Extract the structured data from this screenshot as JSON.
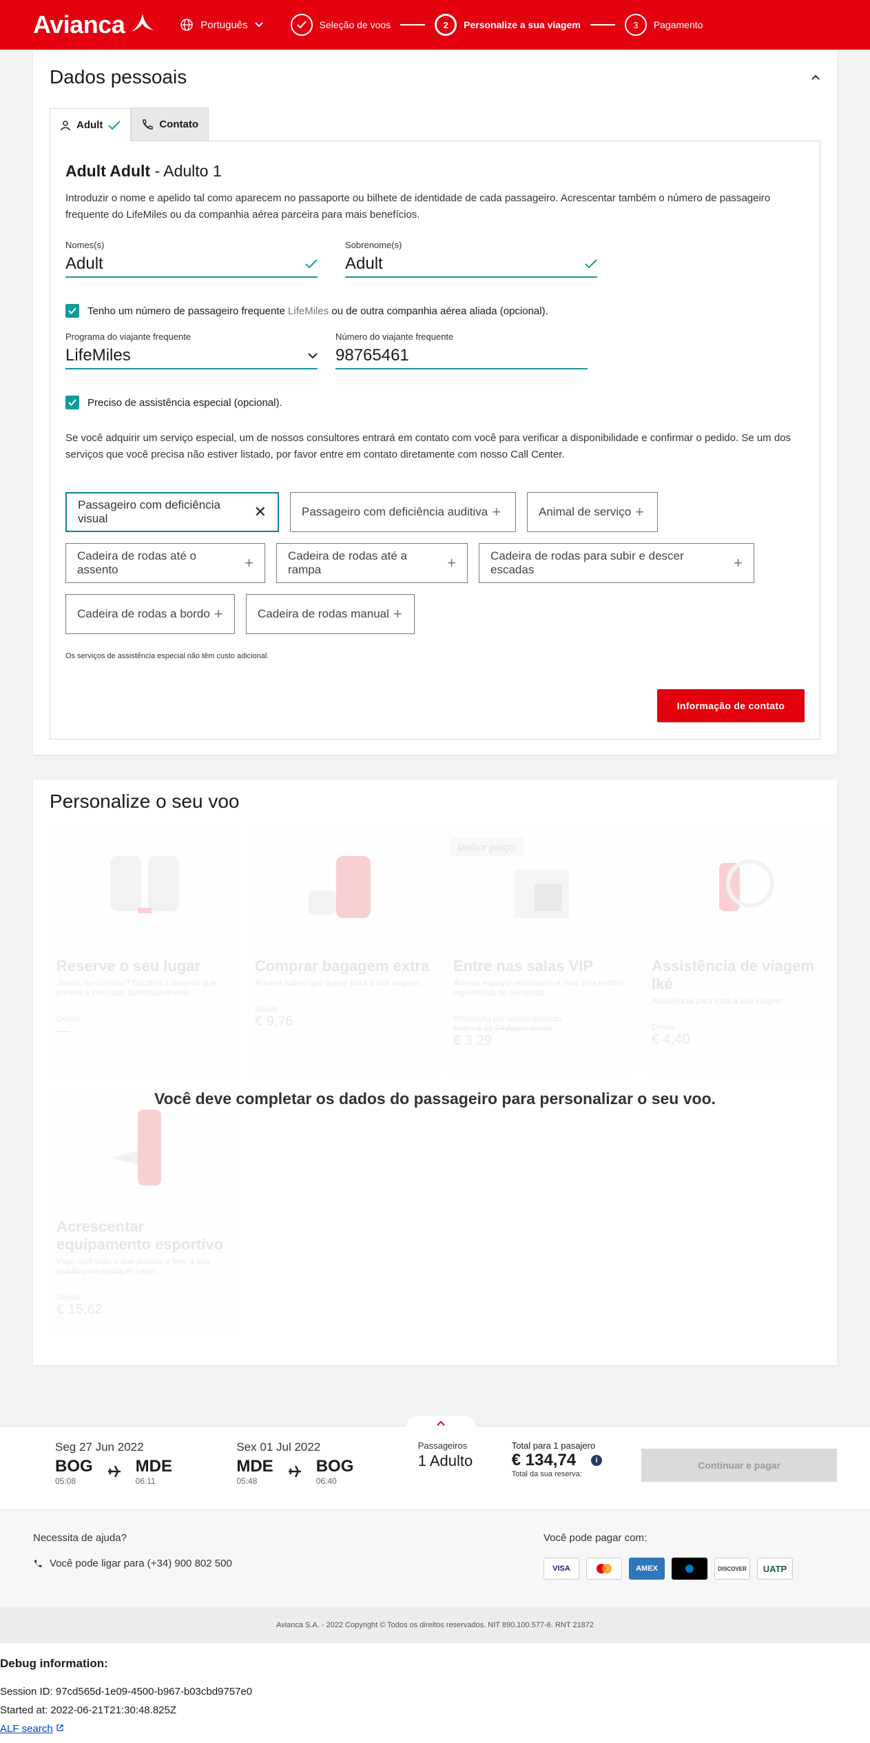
{
  "header": {
    "brand": "Avianca",
    "language": "Português",
    "steps": [
      {
        "number": "",
        "label": "Seleção de voos"
      },
      {
        "number": "2",
        "label": "Personalize a sua viagem"
      },
      {
        "number": "3",
        "label": "Pagamento"
      }
    ]
  },
  "personal": {
    "title": "Dados pessoais",
    "tabs": [
      {
        "label": "Adult"
      },
      {
        "label": "Contato"
      }
    ],
    "passenger_name": "Adult Adult",
    "passenger_index": "- Adulto 1",
    "intro": "Introduzir o nome e apelido tal como aparecem no passaporte ou bilhete de identidade de cada passageiro. Acrescentar também o número de passageiro frequente do LifeMiles ou da companhia aérea parceira para mais benefícios.",
    "first_name_label": "Nomes(s)",
    "first_name_value": "Adult",
    "last_name_label": "Sobrenome(s)",
    "last_name_value": "Adult",
    "ff_check_pre": "Tenho um número de passageiro frequente",
    "ff_check_brand": "LifeMiles",
    "ff_check_post": "ou de outra companhia aérea aliada (opcional).",
    "program_label": "Programa do viajante frequente",
    "program_value": "LifeMiles",
    "ff_number_label": "Número do viajante frequente",
    "ff_number_value": "98765461",
    "assist_check": "Preciso de assistência especial (opcional).",
    "assist_info": "Se você adquirir um serviço especial, um de nossos consultores entrará em contato com você para verificar a disponibilidade e confirmar o pedido. Se um dos serviços que você precisa não estiver listado, por favor entre em contato diretamente com nosso Call Center.",
    "services": [
      {
        "label": "Passageiro com deficiência visual",
        "selected": true
      },
      {
        "label": "Passageiro com deficiência auditiva",
        "selected": false
      },
      {
        "label": "Animal de serviço",
        "selected": false
      },
      {
        "label": "Cadeira de rodas até o assento",
        "selected": false
      },
      {
        "label": "Cadeira de rodas até a rampa",
        "selected": false
      },
      {
        "label": "Cadeira de rodas para subir e descer escadas",
        "selected": false
      },
      {
        "label": "Cadeira de rodas a bordo",
        "selected": false
      },
      {
        "label": "Cadeira de rodas manual",
        "selected": false
      }
    ],
    "footnote": "Os serviços de assistência especial não têm custo adicional.",
    "contact_button": "Informação de contato"
  },
  "personalize": {
    "title": "Personalize o seu voo",
    "locked_message": "Você deve completar os dados do passageiro para personalizar o seu voo.",
    "tiles": [
      {
        "title": "Reserve o seu lugar",
        "desc": "Janela ou corredor? Escolha o assento que prefere e voe mais confortavelmente.",
        "from": "Desde",
        "price": "—",
        "badge": "",
        "promo": "",
        "old": ""
      },
      {
        "title": "Comprar bagagem extra",
        "desc": "Arrume tudo o que quiser para a sua viagem.",
        "from": "Desde",
        "price": "€ 9,76",
        "badge": "",
        "promo": "",
        "old": ""
      },
      {
        "title": "Entre nas salas VIP",
        "desc": "Acesse espaços exclusivos e viva uma melhor experiência no aeroporto",
        "from": "Promoção por tempo limitado",
        "price": "€ 3,29",
        "badge": "Melhor preço!",
        "promo": "Antes € 32,94 Agora desde",
        "old": ""
      },
      {
        "title": "Assistência de viagem Iké",
        "desc": "Assistência para toda a sua viagem",
        "from": "Desde",
        "price": "€ 4,40",
        "badge": "",
        "promo": "",
        "old": ""
      },
      {
        "title": "Acrescentar equipamento esportivo",
        "desc": "Viaje com tudo o que precisa e leve a sua paixão para qualquer lugar.",
        "from": "Desde",
        "price": "€ 15,62",
        "badge": "",
        "promo": "",
        "old": ""
      }
    ]
  },
  "summary": {
    "legs": [
      {
        "date": "Seg 27 Jun 2022",
        "from": "BOG",
        "from_time": "05:08",
        "to": "MDE",
        "to_time": "06:11"
      },
      {
        "date": "Sex 01 Jul 2022",
        "from": "MDE",
        "from_time": "05:48",
        "to": "BOG",
        "to_time": "06:40"
      }
    ],
    "pax_label": "Passageiros",
    "pax_value": "1 Adulto",
    "total_label": "Total para 1 pasajero",
    "total_value": "€ 134,74",
    "total_sub": "Total da sua reserva:",
    "continue_button": "Continuar e pagar"
  },
  "help": {
    "title": "Necessita de ajuda?",
    "phone_text": "Você pode ligar para (+34) 900 802 500",
    "pay_title": "Você pode pagar com:",
    "cards": [
      "VISA",
      "",
      "AMEX",
      "",
      "DISCOVER",
      "UATP"
    ]
  },
  "copyright": "Avianca S.A. - 2022 Copyright © Todos os direitos reservados. NIT 890.100.577-6. RNT 21872",
  "debug": {
    "title": "Debug information:",
    "session": "Session ID: 97cd565d-1e09-4500-b967-b03cbd9757e0",
    "started": "Started at: 2022-06-21T21:30:48.825Z",
    "link": "ALF search"
  },
  "colors": {
    "brand_red": "#e3000f",
    "teal": "#119c9c",
    "selected_chip": "#0b7fa3"
  }
}
